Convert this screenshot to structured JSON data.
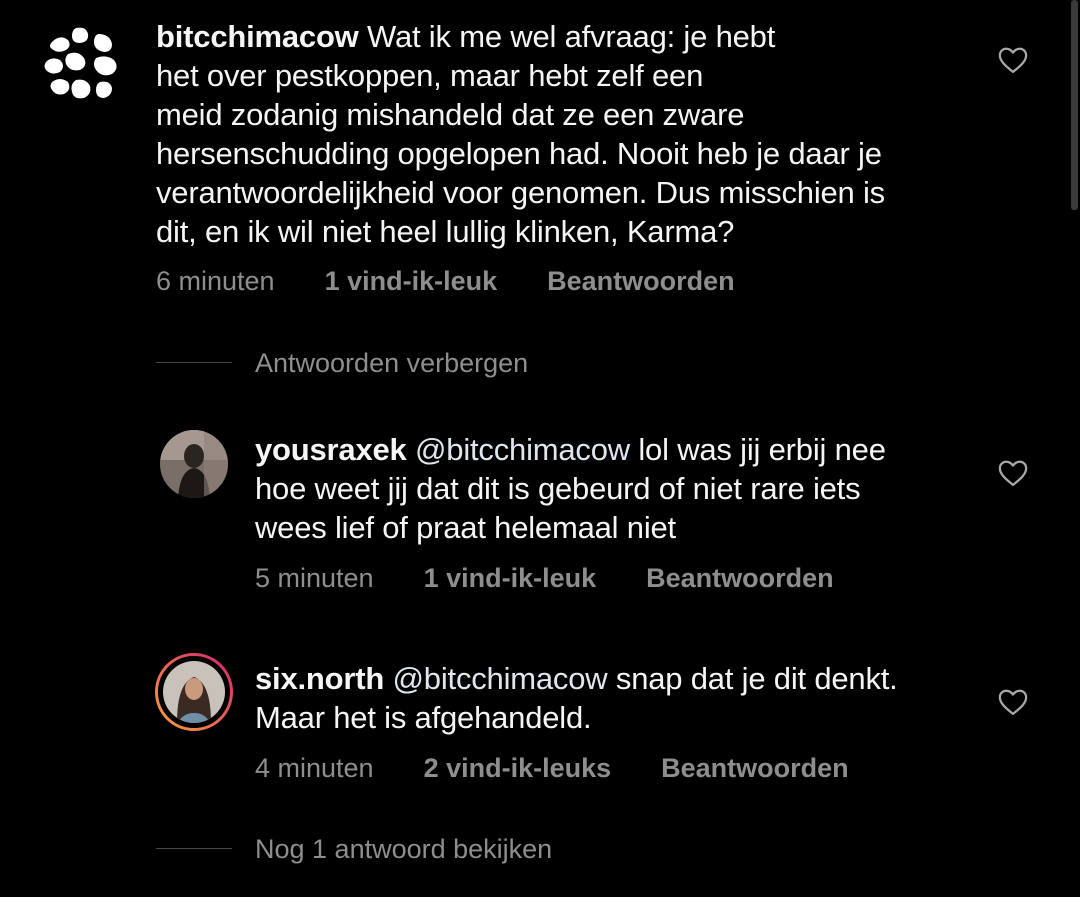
{
  "comments": [
    {
      "username": "bitcchimacow",
      "lines": [
        "Wat ik me wel afvraag: je hebt",
        "het over pestkoppen, maar hebt zelf een",
        "meid zodanig mishandeld dat ze een zware",
        "hersenschudding opgelopen had. Nooit heb je daar je",
        "verantwoordelijkheid voor genomen. Dus misschien is",
        "dit, en ik wil niet heel lullig klinken, Karma?"
      ],
      "time": "6 minuten",
      "likes": "1 vind-ik-leuk",
      "reply": "Beantwoorden"
    },
    {
      "username": "yousraxek",
      "mention": "@bitcchimacow",
      "lines": [
        "lol was jij erbij nee",
        "hoe weet jij dat dit is gebeurd of niet rare iets",
        "wees lief of praat helemaal niet"
      ],
      "time": "5 minuten",
      "likes": "1 vind-ik-leuk",
      "reply": "Beantwoorden"
    },
    {
      "username": "six.north",
      "mention": "@bitcchimacow",
      "lines": [
        "snap dat je dit denkt.",
        "Maar het is afgehandeld."
      ],
      "time": "4 minuten",
      "likes": "2 vind-ik-leuks",
      "reply": "Beantwoorden"
    }
  ],
  "thread": {
    "hide_label": "Antwoorden verbergen",
    "more_label": "Nog 1 antwoord bekijken"
  },
  "colors": {
    "background": "#000000",
    "text": "#f5f5f5",
    "secondary": "#8e8e8e",
    "story_ring_start": "#f9a13b",
    "story_ring_end": "#d3246f"
  },
  "icons": {
    "like": "heart-outline-icon"
  }
}
